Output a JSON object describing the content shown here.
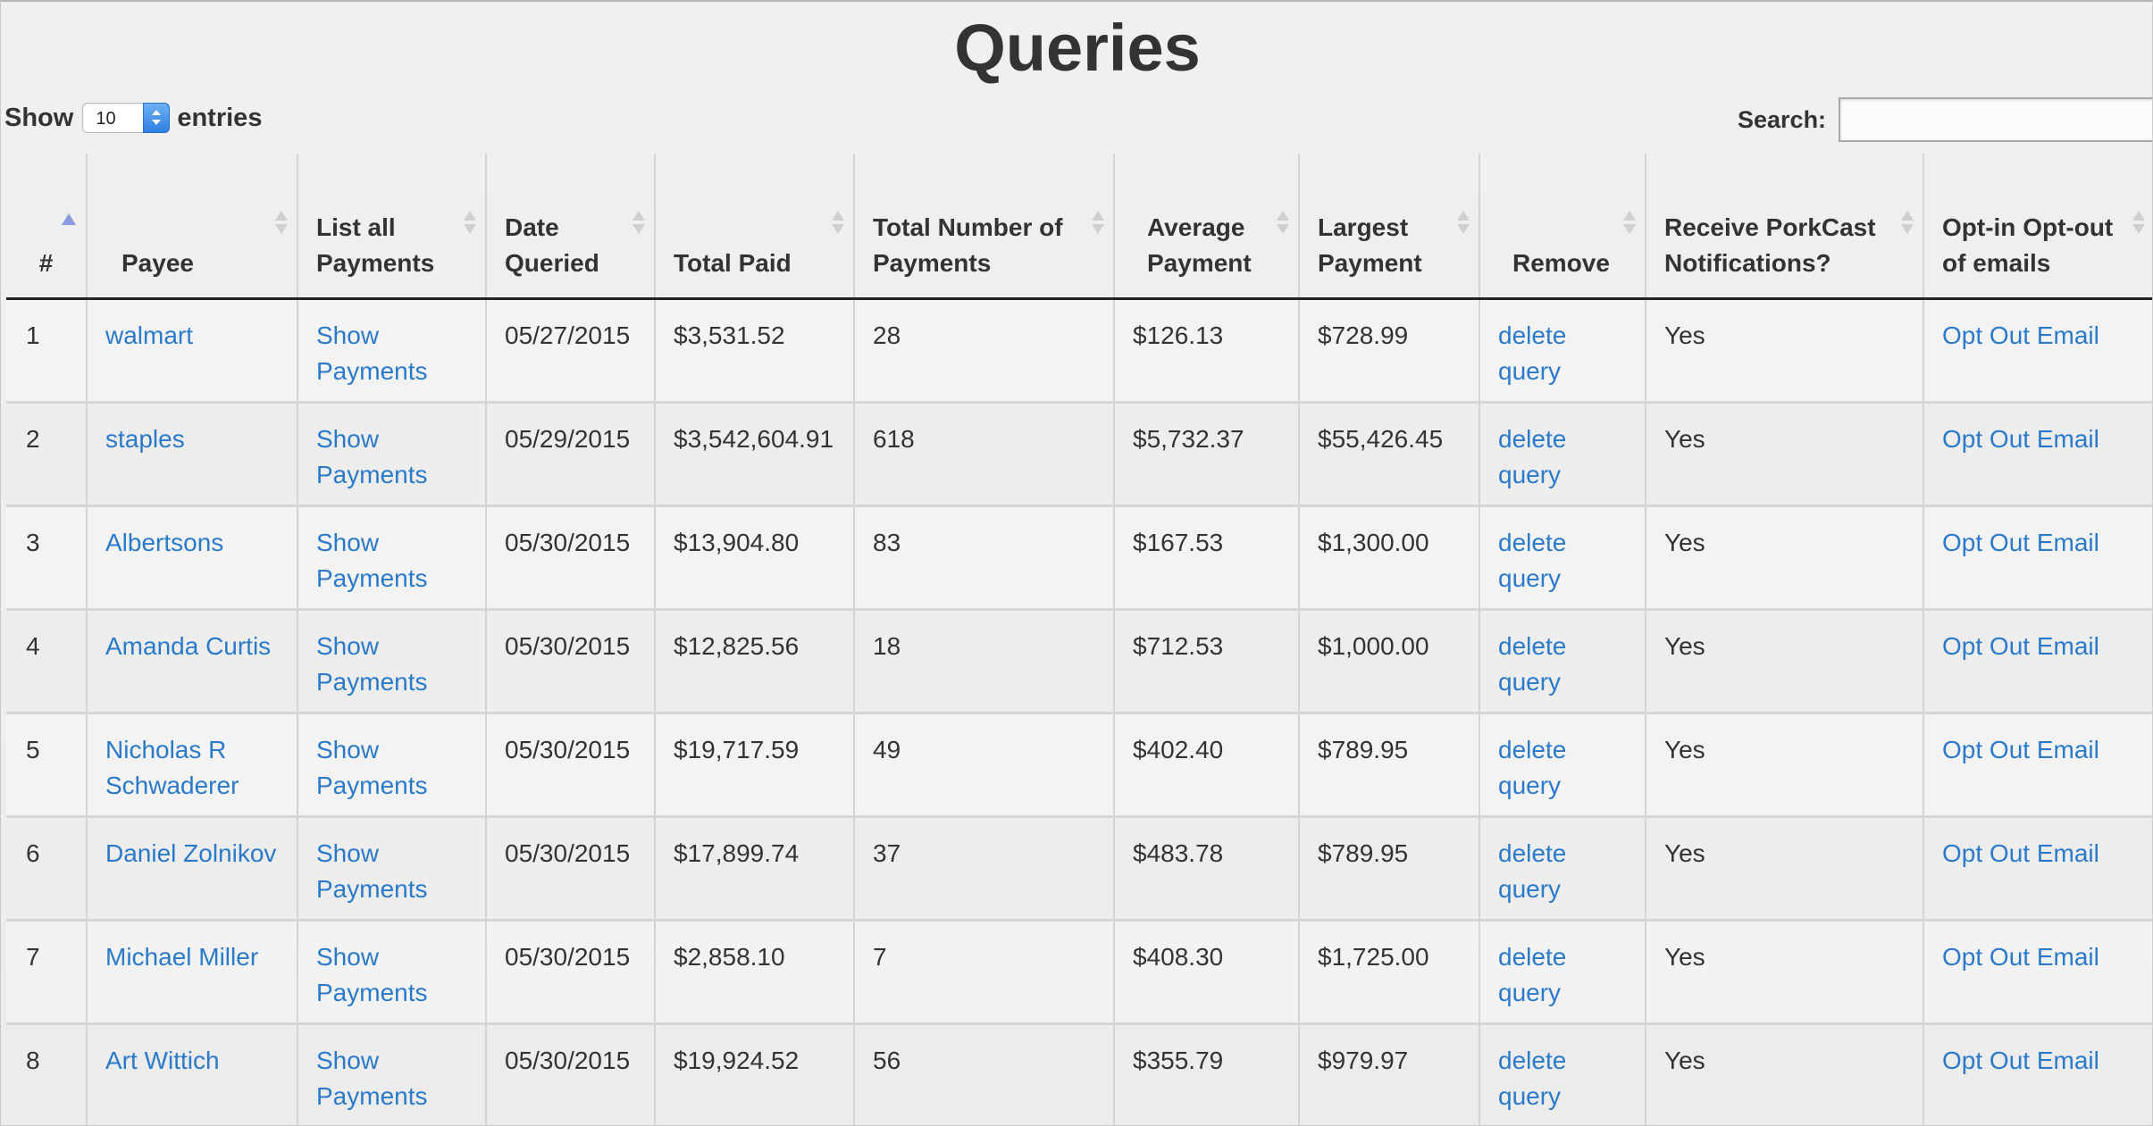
{
  "page": {
    "title": "Queries"
  },
  "length": {
    "show_label": "Show",
    "selected": "10",
    "entries_label": "entries"
  },
  "search": {
    "label": "Search:",
    "value": ""
  },
  "colors": {
    "link": "#2a7ac9",
    "sort_active": "#8b99e0",
    "select_button": "#2f7fe3"
  },
  "table": {
    "sort_column": "#",
    "sort_direction": "ascending",
    "columns": [
      "#",
      "Payee",
      "List all Payments",
      "Date Queried",
      "Total Paid",
      "Total Number of Payments",
      "Average Payment",
      "Largest Payment",
      "Remove",
      "Receive PorkCast Notifications?",
      "Opt-in Opt-out of emails"
    ],
    "rows": [
      {
        "num": "1",
        "payee": "walmart",
        "list": "Show Payments",
        "date": "05/27/2015",
        "total_paid": "$3,531.52",
        "count": "28",
        "average": "$126.13",
        "largest": "$728.99",
        "remove": "delete query",
        "notify": "Yes",
        "optout": "Opt Out Email"
      },
      {
        "num": "2",
        "payee": "staples",
        "list": "Show Payments",
        "date": "05/29/2015",
        "total_paid": "$3,542,604.91",
        "count": "618",
        "average": "$5,732.37",
        "largest": "$55,426.45",
        "remove": "delete query",
        "notify": "Yes",
        "optout": "Opt Out Email"
      },
      {
        "num": "3",
        "payee": "Albertsons",
        "list": "Show Payments",
        "date": "05/30/2015",
        "total_paid": "$13,904.80",
        "count": "83",
        "average": "$167.53",
        "largest": "$1,300.00",
        "remove": "delete query",
        "notify": "Yes",
        "optout": "Opt Out Email"
      },
      {
        "num": "4",
        "payee": "Amanda Curtis",
        "list": "Show Payments",
        "date": "05/30/2015",
        "total_paid": "$12,825.56",
        "count": "18",
        "average": "$712.53",
        "largest": "$1,000.00",
        "remove": "delete query",
        "notify": "Yes",
        "optout": "Opt Out Email"
      },
      {
        "num": "5",
        "payee": "Nicholas R Schwaderer",
        "list": "Show Payments",
        "date": "05/30/2015",
        "total_paid": "$19,717.59",
        "count": "49",
        "average": "$402.40",
        "largest": "$789.95",
        "remove": "delete query",
        "notify": "Yes",
        "optout": "Opt Out Email"
      },
      {
        "num": "6",
        "payee": "Daniel Zolnikov",
        "list": "Show Payments",
        "date": "05/30/2015",
        "total_paid": "$17,899.74",
        "count": "37",
        "average": "$483.78",
        "largest": "$789.95",
        "remove": "delete query",
        "notify": "Yes",
        "optout": "Opt Out Email"
      },
      {
        "num": "7",
        "payee": "Michael Miller",
        "list": "Show Payments",
        "date": "05/30/2015",
        "total_paid": "$2,858.10",
        "count": "7",
        "average": "$408.30",
        "largest": "$1,725.00",
        "remove": "delete query",
        "notify": "Yes",
        "optout": "Opt Out Email"
      },
      {
        "num": "8",
        "payee": "Art Wittich",
        "list": "Show Payments",
        "date": "05/30/2015",
        "total_paid": "$19,924.52",
        "count": "56",
        "average": "$355.79",
        "largest": "$979.97",
        "remove": "delete query",
        "notify": "Yes",
        "optout": "Opt Out Email"
      }
    ]
  }
}
